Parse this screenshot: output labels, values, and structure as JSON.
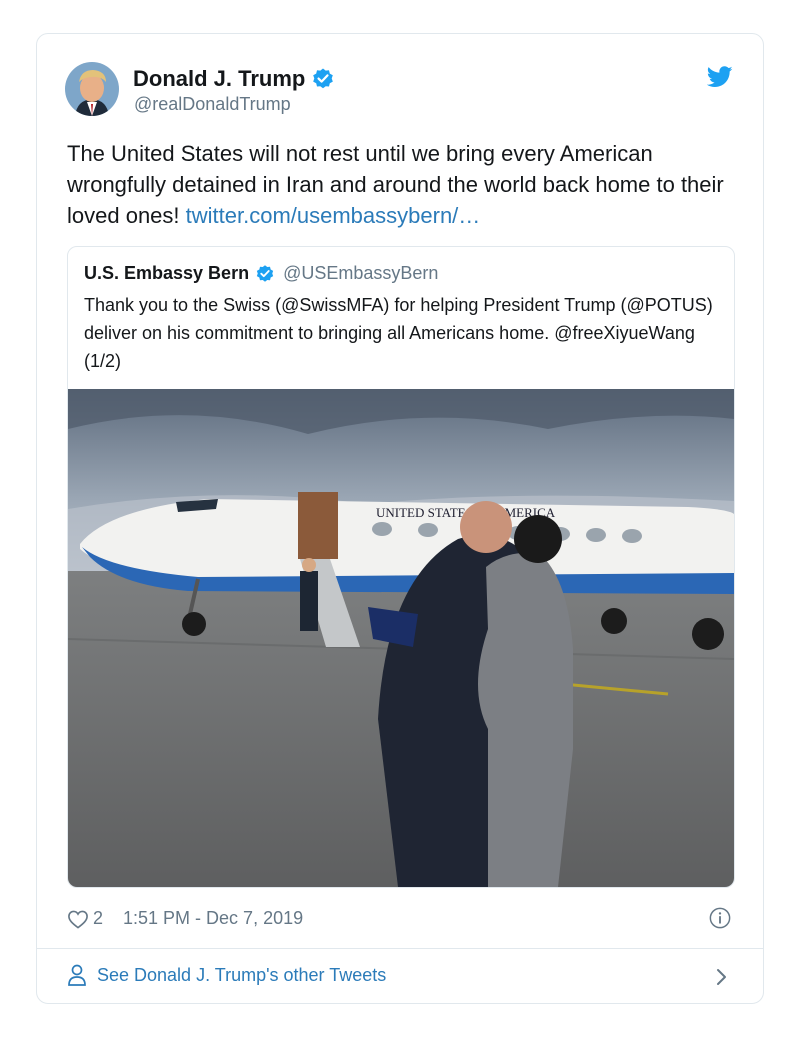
{
  "tweet": {
    "author_name": "Donald J. Trump",
    "author_handle": "@realDonaldTrump",
    "text": "The United States will not rest until we bring every American wrongfully detained in Iran and around the world back home to their loved ones! ",
    "link_text": "twitter.com/usembassybern/…",
    "likes": "2",
    "timestamp": "1:51 PM - Dec 7, 2019"
  },
  "quoted_tweet": {
    "author_name": "U.S. Embassy Bern",
    "author_handle": "@USEmbassyBern",
    "text": "Thank you to the Swiss (@SwissMFA) for helping President Trump (@POTUS) deliver on his commitment to bringing all Americans home. @freeXiyueWang (1/2)",
    "photo_plane_text": "UNITED STATES OF AMERICA"
  },
  "footer": {
    "see_more": "See Donald J. Trump's other Tweets"
  },
  "icons": {
    "verified": "verified-badge-icon",
    "bird": "twitter-bird-icon",
    "heart": "heart-icon",
    "info": "info-icon",
    "person": "person-icon",
    "chevron": "chevron-right-icon"
  },
  "colors": {
    "brand_blue": "#1da1f2",
    "link": "#2b7bb9",
    "text": "#14171a",
    "muted": "#657786",
    "border": "#e1e8ed"
  }
}
